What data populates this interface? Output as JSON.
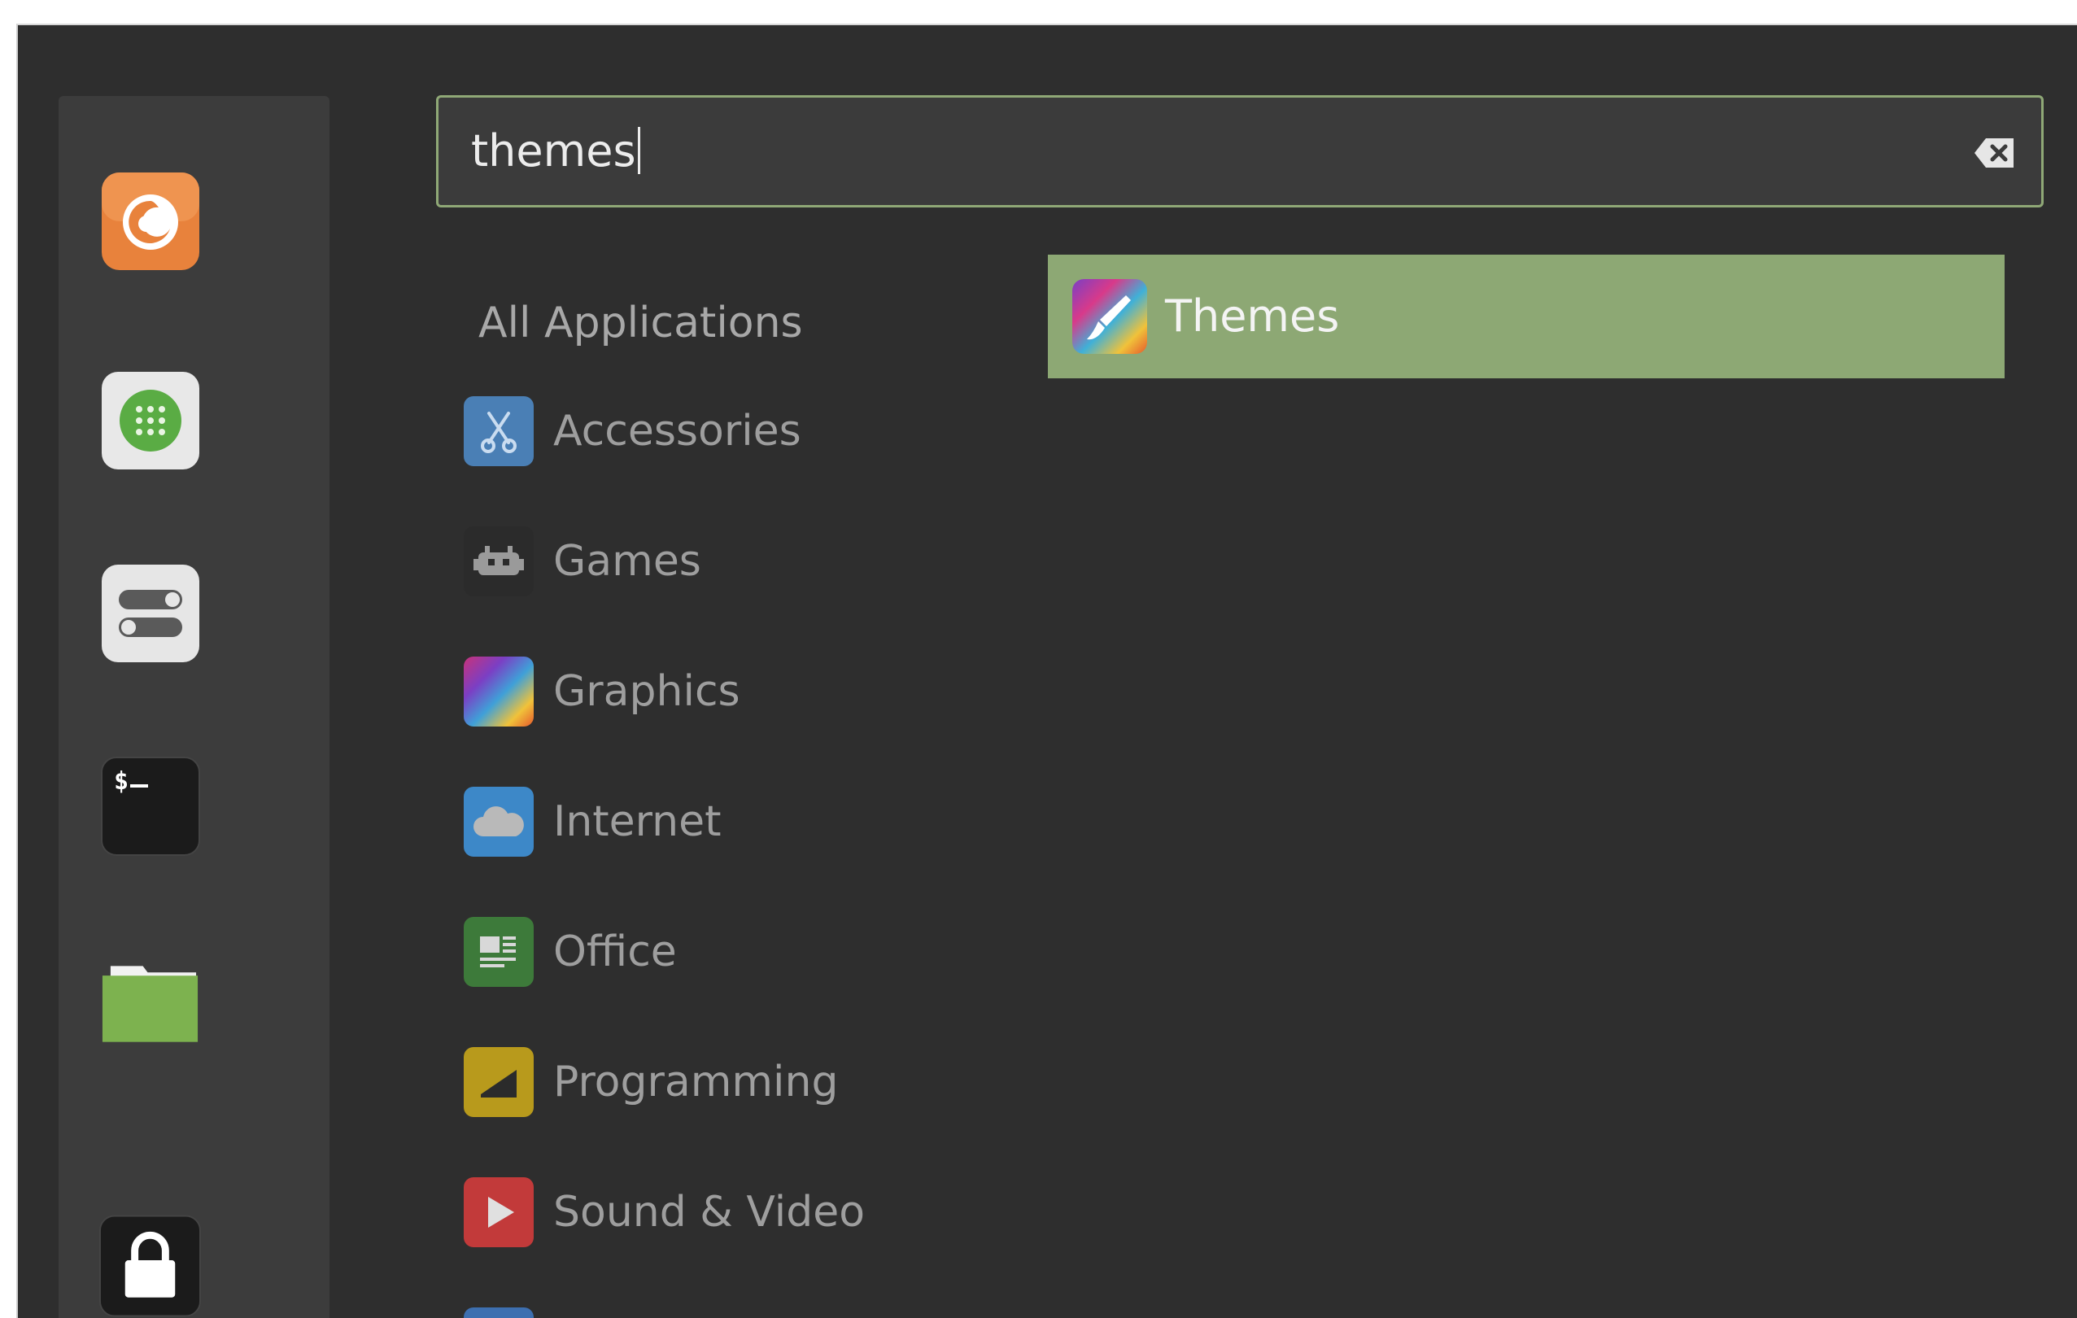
{
  "search": {
    "value": "themes",
    "clear_icon": "backspace-clear-icon"
  },
  "favorites": [
    {
      "name": "Firefox",
      "icon": "firefox-icon"
    },
    {
      "name": "Software Manager",
      "icon": "software-manager-icon"
    },
    {
      "name": "System Settings",
      "icon": "system-settings-icon"
    },
    {
      "name": "Terminal",
      "icon": "terminal-icon"
    },
    {
      "name": "Files",
      "icon": "folder-icon"
    },
    {
      "name": "Lock Screen",
      "icon": "lock-icon"
    }
  ],
  "categories": {
    "all_label": "All Applications",
    "items": [
      {
        "label": "Accessories",
        "icon": "accessories-icon",
        "color": "#4a7fb5"
      },
      {
        "label": "Games",
        "icon": "games-icon",
        "color": "#2b2b2b"
      },
      {
        "label": "Graphics",
        "icon": "graphics-icon",
        "color": "#8a3fb5"
      },
      {
        "label": "Internet",
        "icon": "internet-icon",
        "color": "#3d88c8"
      },
      {
        "label": "Office",
        "icon": "office-icon",
        "color": "#3d7a3a"
      },
      {
        "label": "Programming",
        "icon": "programming-icon",
        "color": "#b89a1c"
      },
      {
        "label": "Sound & Video",
        "icon": "sound-video-icon",
        "color": "#c23a3a"
      }
    ]
  },
  "results": [
    {
      "label": "Themes",
      "icon": "themes-icon",
      "selected": true
    }
  ],
  "colors": {
    "accent": "#8da874",
    "background": "#2e2e2e",
    "sidebar": "#3c3c3c"
  }
}
